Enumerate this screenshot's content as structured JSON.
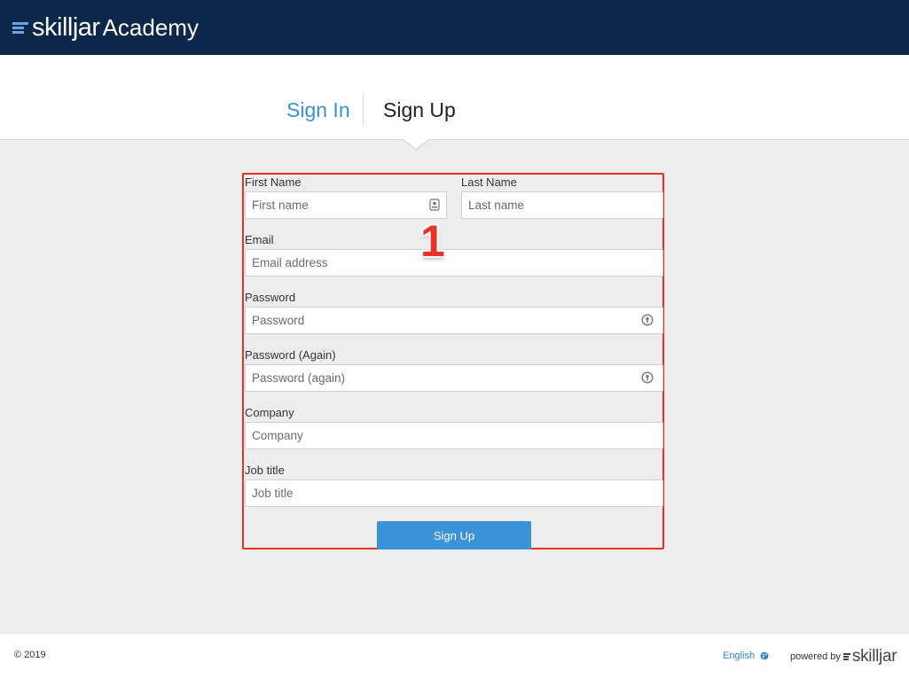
{
  "header": {
    "logo_word": "skilljar",
    "logo_suffix": "Academy",
    "logo_mark_icon": "skilljar-logo-mark"
  },
  "tabs": {
    "sign_in": "Sign In",
    "sign_up": "Sign Up",
    "active": "Sign Up"
  },
  "form": {
    "first_name": {
      "label": "First Name",
      "placeholder": "First name",
      "icon": "contact-card-icon"
    },
    "last_name": {
      "label": "Last Name",
      "placeholder": "Last name"
    },
    "email": {
      "label": "Email",
      "placeholder": "Email address"
    },
    "password": {
      "label": "Password",
      "placeholder": "Password",
      "icon": "password-key-icon"
    },
    "password_again": {
      "label": "Password (Again)",
      "placeholder": "Password (again)",
      "icon": "password-key-icon"
    },
    "company": {
      "label": "Company",
      "placeholder": "Company"
    },
    "job_title": {
      "label": "Job title",
      "placeholder": "Job title"
    },
    "submit_label": "Sign Up"
  },
  "annotation": {
    "number": "1",
    "color": "#ea3323"
  },
  "footer": {
    "copyright": "© 2019",
    "language": "English",
    "language_icon": "globe-icon",
    "powered_by": "powered by",
    "powered_logo": "skilljar"
  },
  "colors": {
    "header_bg": "#0b2749",
    "accent_blue": "#3a93d6",
    "page_bg": "#ededed"
  }
}
